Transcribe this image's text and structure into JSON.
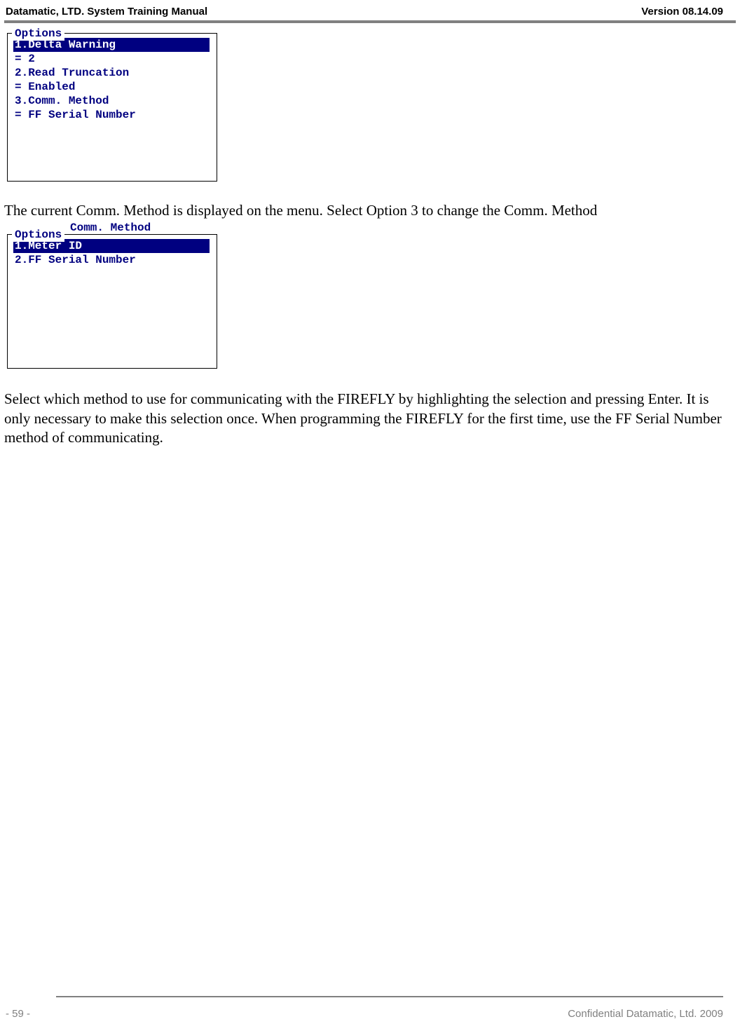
{
  "header": {
    "left": "Datamatic, LTD. System Training  Manual",
    "right": "Version 08.14.09"
  },
  "box1": {
    "legend": "Options",
    "lines": [
      {
        "text": "1.Delta Warning",
        "hl": true
      },
      {
        "text": " = 2",
        "hl": false
      },
      {
        "text": "2.Read Truncation",
        "hl": false
      },
      {
        "text": " = Enabled",
        "hl": false
      },
      {
        "text": "3.Comm. Method",
        "hl": false
      },
      {
        "text": " = FF Serial Number",
        "hl": false
      }
    ]
  },
  "para1": "The current Comm. Method is displayed on the menu.  Select Option 3 to change the Comm. Method",
  "box2_header": "Comm. Method",
  "box2": {
    "legend": "Options",
    "lines": [
      {
        "text": "1.Meter ID",
        "hl": true
      },
      {
        "text": "2.FF Serial Number",
        "hl": false
      }
    ]
  },
  "para2": "Select which method to use for communicating with the FIREFLY by highlighting the selection and pressing Enter.  It is only necessary to make this selection once. When programming the FIREFLY for the first time, use the FF Serial Number method of communicating.",
  "footer": {
    "left": "- 59 -",
    "right": "Confidential Datamatic, Ltd. 2009"
  }
}
